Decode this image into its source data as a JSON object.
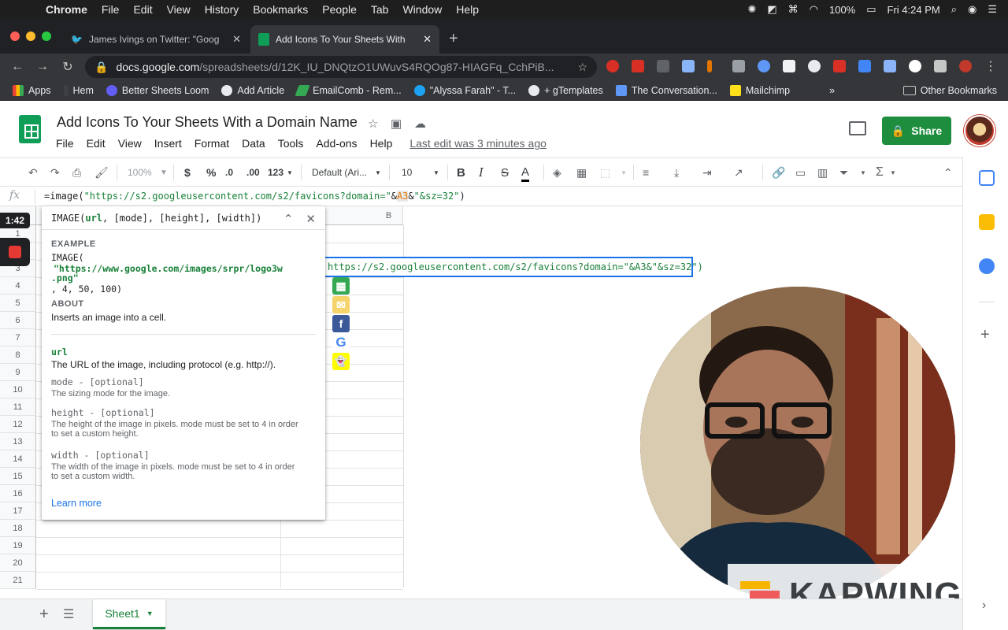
{
  "mac_menu": {
    "apple": "",
    "items": [
      "Chrome",
      "File",
      "Edit",
      "View",
      "History",
      "Bookmarks",
      "People",
      "Tab",
      "Window",
      "Help"
    ],
    "battery": "100%",
    "clock": "Fri 4:24 PM"
  },
  "tabs": [
    {
      "title": "James Ivings on Twitter: \"Goog",
      "active": false
    },
    {
      "title": "Add Icons To Your Sheets With",
      "active": true
    }
  ],
  "omnibox": {
    "host": "docs.google.com",
    "path": "/spreadsheets/d/12K_IU_DNQtzO1UWuvS4RQOg87-HIAGFq_CchPiB..."
  },
  "bookmarks": {
    "items": [
      "Apps",
      "Hem",
      "Better Sheets Loom",
      "Add Article",
      "EmailComb - Rem...",
      "\"Alyssa Farah\" - T...",
      "+ gTemplates",
      "The Conversation...",
      "Mailchimp"
    ],
    "overflow": "»",
    "other": "Other Bookmarks"
  },
  "doc": {
    "title": "Add Icons To Your Sheets With a Domain Name",
    "menus": [
      "File",
      "Edit",
      "View",
      "Insert",
      "Format",
      "Data",
      "Tools",
      "Add-ons",
      "Help"
    ],
    "last_edit": "Last edit was 3 minutes ago",
    "share_label": "Share"
  },
  "format_toolbar": {
    "zoom": "100%",
    "currency": "$",
    "percent": "%",
    "dec_dec": ".0",
    "dec_inc": ".00",
    "more_formats": "123",
    "font": "Default (Ari...",
    "font_size": "10",
    "bold": "B",
    "italic": "I",
    "strike": "S",
    "textcolor": "A",
    "functions": "Σ"
  },
  "formula_bar": {
    "fx": "fx",
    "part1": "=image(",
    "part2": "\"https://s2.googleusercontent.com/s2/favicons?domain=\"",
    "part3": "&",
    "part4": "A3",
    "part5": "&",
    "part6": "\"&sz=32\"",
    "part7": ")"
  },
  "grid": {
    "column_b": "B",
    "rows": [
      "1",
      "2",
      "3",
      "4",
      "5",
      "6",
      "7",
      "8",
      "9",
      "10",
      "11",
      "12",
      "13",
      "14",
      "15",
      "16",
      "17",
      "18",
      "19",
      "20",
      "21"
    ],
    "edit_text": "https://s2.googleusercontent.com/s2/favicons?domain=\"&A3&\"&sz=32\")",
    "favicons": [
      {
        "name": "sheets-favicon",
        "color": "#34a853",
        "glyph": "▦"
      },
      {
        "name": "email-favicon",
        "color": "#f6d36b",
        "glyph": "✉"
      },
      {
        "name": "facebook-favicon",
        "color": "#3b5998",
        "glyph": "f"
      },
      {
        "name": "google-favicon",
        "color": "#ffffff",
        "glyph": "G"
      },
      {
        "name": "snapchat-favicon",
        "color": "#fffc00",
        "glyph": "👻"
      }
    ]
  },
  "help_popup": {
    "signature": "IMAGE(url, [mode], [height], [width])",
    "sig_fn": "IMAGE(",
    "sig_url": "url",
    "sig_rest": ", [mode], [height], [width])",
    "example_label": "EXAMPLE",
    "example_1": "IMAGE(",
    "example_2": "\"https://www.google.com/images/srpr/logo3w",
    "example_3": ".png\"",
    "example_4": ", 4, 50, 100)",
    "about_label": "ABOUT",
    "about_text": "Inserts an image into a cell.",
    "url_name": "url",
    "url_desc": "The URL of the image, including protocol (e.g. http://).",
    "mode_name": "mode - [optional]",
    "mode_desc": "The sizing mode for the image.",
    "height_name": "height - [optional]",
    "height_desc": "The height of the image in pixels. mode must be set to 4 in order to set a custom height.",
    "width_name": "width - [optional]",
    "width_desc": "The width of the image in pixels. mode must be set to 4 in order to set a custom width.",
    "learn_more": "Learn more"
  },
  "recorder": {
    "timer": "1:42"
  },
  "watermark": "KAPWING",
  "sheet_tab": "Sheet1",
  "colors": {
    "sheets_green": "#0f9d58",
    "share_green": "#1e8e3e",
    "selection_blue": "#1a73e8",
    "formula_green": "#188038",
    "ref_orange": "#e37400"
  }
}
